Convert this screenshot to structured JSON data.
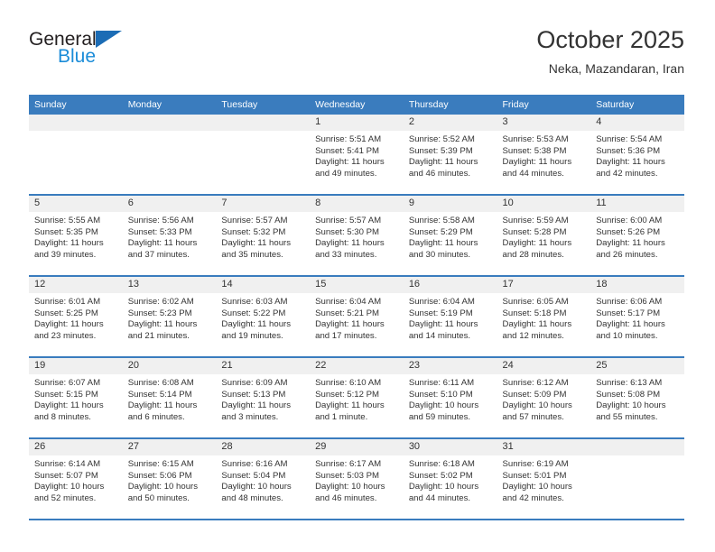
{
  "brand": {
    "name_part1": "General",
    "name_part2": "Blue",
    "flag_icon": "triangle-flag-icon",
    "accent_dark": "#1b6cb5",
    "accent_light": "#1b8cd8"
  },
  "header": {
    "title": "October 2025",
    "subtitle": "Neka, Mazandaran, Iran"
  },
  "theme": {
    "header_blue": "#3a7cbe",
    "daynum_band": "#f0f0f0",
    "text": "#333333"
  },
  "weekday_headers": [
    "Sunday",
    "Monday",
    "Tuesday",
    "Wednesday",
    "Thursday",
    "Friday",
    "Saturday"
  ],
  "weeks": [
    [
      {
        "day": "",
        "sunrise": "",
        "sunset": "",
        "daylight_line1": "",
        "daylight_line2": "",
        "empty": true
      },
      {
        "day": "",
        "sunrise": "",
        "sunset": "",
        "daylight_line1": "",
        "daylight_line2": "",
        "empty": true
      },
      {
        "day": "",
        "sunrise": "",
        "sunset": "",
        "daylight_line1": "",
        "daylight_line2": "",
        "empty": true
      },
      {
        "day": "1",
        "sunrise": "Sunrise: 5:51 AM",
        "sunset": "Sunset: 5:41 PM",
        "daylight_line1": "Daylight: 11 hours",
        "daylight_line2": "and 49 minutes.",
        "empty": false
      },
      {
        "day": "2",
        "sunrise": "Sunrise: 5:52 AM",
        "sunset": "Sunset: 5:39 PM",
        "daylight_line1": "Daylight: 11 hours",
        "daylight_line2": "and 46 minutes.",
        "empty": false
      },
      {
        "day": "3",
        "sunrise": "Sunrise: 5:53 AM",
        "sunset": "Sunset: 5:38 PM",
        "daylight_line1": "Daylight: 11 hours",
        "daylight_line2": "and 44 minutes.",
        "empty": false
      },
      {
        "day": "4",
        "sunrise": "Sunrise: 5:54 AM",
        "sunset": "Sunset: 5:36 PM",
        "daylight_line1": "Daylight: 11 hours",
        "daylight_line2": "and 42 minutes.",
        "empty": false
      }
    ],
    [
      {
        "day": "5",
        "sunrise": "Sunrise: 5:55 AM",
        "sunset": "Sunset: 5:35 PM",
        "daylight_line1": "Daylight: 11 hours",
        "daylight_line2": "and 39 minutes.",
        "empty": false
      },
      {
        "day": "6",
        "sunrise": "Sunrise: 5:56 AM",
        "sunset": "Sunset: 5:33 PM",
        "daylight_line1": "Daylight: 11 hours",
        "daylight_line2": "and 37 minutes.",
        "empty": false
      },
      {
        "day": "7",
        "sunrise": "Sunrise: 5:57 AM",
        "sunset": "Sunset: 5:32 PM",
        "daylight_line1": "Daylight: 11 hours",
        "daylight_line2": "and 35 minutes.",
        "empty": false
      },
      {
        "day": "8",
        "sunrise": "Sunrise: 5:57 AM",
        "sunset": "Sunset: 5:30 PM",
        "daylight_line1": "Daylight: 11 hours",
        "daylight_line2": "and 33 minutes.",
        "empty": false
      },
      {
        "day": "9",
        "sunrise": "Sunrise: 5:58 AM",
        "sunset": "Sunset: 5:29 PM",
        "daylight_line1": "Daylight: 11 hours",
        "daylight_line2": "and 30 minutes.",
        "empty": false
      },
      {
        "day": "10",
        "sunrise": "Sunrise: 5:59 AM",
        "sunset": "Sunset: 5:28 PM",
        "daylight_line1": "Daylight: 11 hours",
        "daylight_line2": "and 28 minutes.",
        "empty": false
      },
      {
        "day": "11",
        "sunrise": "Sunrise: 6:00 AM",
        "sunset": "Sunset: 5:26 PM",
        "daylight_line1": "Daylight: 11 hours",
        "daylight_line2": "and 26 minutes.",
        "empty": false
      }
    ],
    [
      {
        "day": "12",
        "sunrise": "Sunrise: 6:01 AM",
        "sunset": "Sunset: 5:25 PM",
        "daylight_line1": "Daylight: 11 hours",
        "daylight_line2": "and 23 minutes.",
        "empty": false
      },
      {
        "day": "13",
        "sunrise": "Sunrise: 6:02 AM",
        "sunset": "Sunset: 5:23 PM",
        "daylight_line1": "Daylight: 11 hours",
        "daylight_line2": "and 21 minutes.",
        "empty": false
      },
      {
        "day": "14",
        "sunrise": "Sunrise: 6:03 AM",
        "sunset": "Sunset: 5:22 PM",
        "daylight_line1": "Daylight: 11 hours",
        "daylight_line2": "and 19 minutes.",
        "empty": false
      },
      {
        "day": "15",
        "sunrise": "Sunrise: 6:04 AM",
        "sunset": "Sunset: 5:21 PM",
        "daylight_line1": "Daylight: 11 hours",
        "daylight_line2": "and 17 minutes.",
        "empty": false
      },
      {
        "day": "16",
        "sunrise": "Sunrise: 6:04 AM",
        "sunset": "Sunset: 5:19 PM",
        "daylight_line1": "Daylight: 11 hours",
        "daylight_line2": "and 14 minutes.",
        "empty": false
      },
      {
        "day": "17",
        "sunrise": "Sunrise: 6:05 AM",
        "sunset": "Sunset: 5:18 PM",
        "daylight_line1": "Daylight: 11 hours",
        "daylight_line2": "and 12 minutes.",
        "empty": false
      },
      {
        "day": "18",
        "sunrise": "Sunrise: 6:06 AM",
        "sunset": "Sunset: 5:17 PM",
        "daylight_line1": "Daylight: 11 hours",
        "daylight_line2": "and 10 minutes.",
        "empty": false
      }
    ],
    [
      {
        "day": "19",
        "sunrise": "Sunrise: 6:07 AM",
        "sunset": "Sunset: 5:15 PM",
        "daylight_line1": "Daylight: 11 hours",
        "daylight_line2": "and 8 minutes.",
        "empty": false
      },
      {
        "day": "20",
        "sunrise": "Sunrise: 6:08 AM",
        "sunset": "Sunset: 5:14 PM",
        "daylight_line1": "Daylight: 11 hours",
        "daylight_line2": "and 6 minutes.",
        "empty": false
      },
      {
        "day": "21",
        "sunrise": "Sunrise: 6:09 AM",
        "sunset": "Sunset: 5:13 PM",
        "daylight_line1": "Daylight: 11 hours",
        "daylight_line2": "and 3 minutes.",
        "empty": false
      },
      {
        "day": "22",
        "sunrise": "Sunrise: 6:10 AM",
        "sunset": "Sunset: 5:12 PM",
        "daylight_line1": "Daylight: 11 hours",
        "daylight_line2": "and 1 minute.",
        "empty": false
      },
      {
        "day": "23",
        "sunrise": "Sunrise: 6:11 AM",
        "sunset": "Sunset: 5:10 PM",
        "daylight_line1": "Daylight: 10 hours",
        "daylight_line2": "and 59 minutes.",
        "empty": false
      },
      {
        "day": "24",
        "sunrise": "Sunrise: 6:12 AM",
        "sunset": "Sunset: 5:09 PM",
        "daylight_line1": "Daylight: 10 hours",
        "daylight_line2": "and 57 minutes.",
        "empty": false
      },
      {
        "day": "25",
        "sunrise": "Sunrise: 6:13 AM",
        "sunset": "Sunset: 5:08 PM",
        "daylight_line1": "Daylight: 10 hours",
        "daylight_line2": "and 55 minutes.",
        "empty": false
      }
    ],
    [
      {
        "day": "26",
        "sunrise": "Sunrise: 6:14 AM",
        "sunset": "Sunset: 5:07 PM",
        "daylight_line1": "Daylight: 10 hours",
        "daylight_line2": "and 52 minutes.",
        "empty": false
      },
      {
        "day": "27",
        "sunrise": "Sunrise: 6:15 AM",
        "sunset": "Sunset: 5:06 PM",
        "daylight_line1": "Daylight: 10 hours",
        "daylight_line2": "and 50 minutes.",
        "empty": false
      },
      {
        "day": "28",
        "sunrise": "Sunrise: 6:16 AM",
        "sunset": "Sunset: 5:04 PM",
        "daylight_line1": "Daylight: 10 hours",
        "daylight_line2": "and 48 minutes.",
        "empty": false
      },
      {
        "day": "29",
        "sunrise": "Sunrise: 6:17 AM",
        "sunset": "Sunset: 5:03 PM",
        "daylight_line1": "Daylight: 10 hours",
        "daylight_line2": "and 46 minutes.",
        "empty": false
      },
      {
        "day": "30",
        "sunrise": "Sunrise: 6:18 AM",
        "sunset": "Sunset: 5:02 PM",
        "daylight_line1": "Daylight: 10 hours",
        "daylight_line2": "and 44 minutes.",
        "empty": false
      },
      {
        "day": "31",
        "sunrise": "Sunrise: 6:19 AM",
        "sunset": "Sunset: 5:01 PM",
        "daylight_line1": "Daylight: 10 hours",
        "daylight_line2": "and 42 minutes.",
        "empty": false
      },
      {
        "day": "",
        "sunrise": "",
        "sunset": "",
        "daylight_line1": "",
        "daylight_line2": "",
        "empty": true
      }
    ]
  ]
}
